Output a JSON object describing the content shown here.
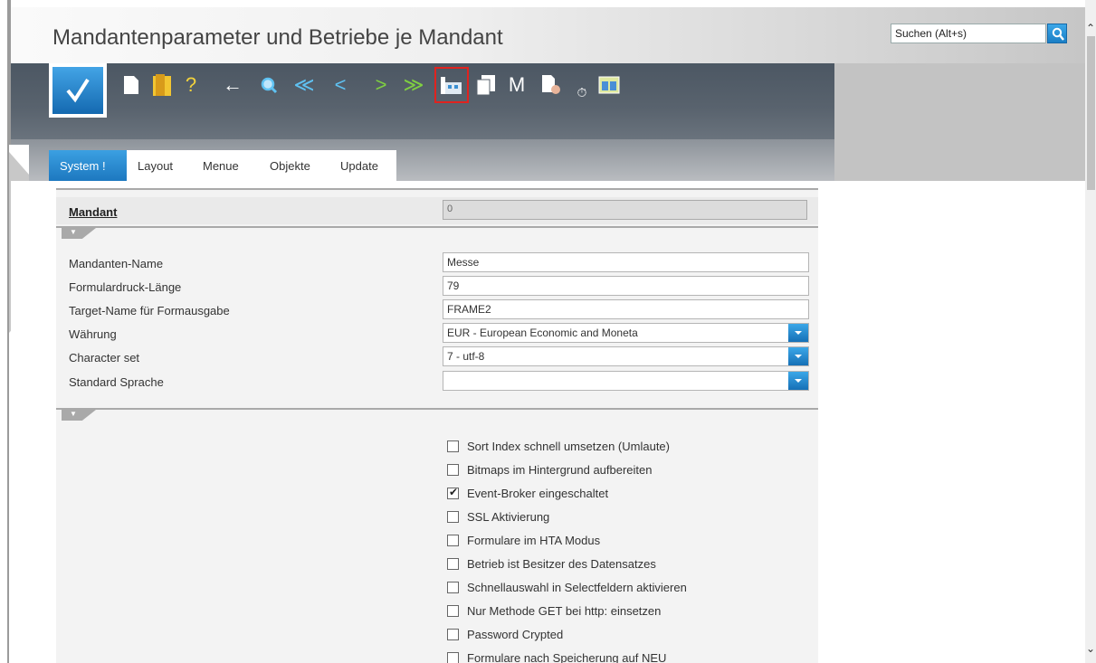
{
  "header": {
    "title": "Mandantenparameter und Betriebe je Mandant"
  },
  "search": {
    "placeholder": "Suchen (Alt+s)"
  },
  "toolbar": {
    "items": [
      {
        "name": "new-document",
        "glyph": "▯"
      },
      {
        "name": "open-folder",
        "glyph": "▮"
      },
      {
        "name": "help",
        "glyph": "?"
      },
      {
        "name": "back",
        "glyph": "←"
      },
      {
        "name": "search",
        "glyph": "⌕"
      },
      {
        "name": "first",
        "glyph": "≪"
      },
      {
        "name": "previous",
        "glyph": "<"
      },
      {
        "name": "next",
        "glyph": ">"
      },
      {
        "name": "last",
        "glyph": "≫"
      },
      {
        "name": "company",
        "glyph": "▦"
      },
      {
        "name": "copy",
        "glyph": "❐"
      },
      {
        "name": "m-mode",
        "glyph": "M"
      },
      {
        "name": "document-hand",
        "glyph": "✋"
      },
      {
        "name": "timer",
        "glyph": "⏱"
      },
      {
        "name": "table-view",
        "glyph": "▤"
      }
    ],
    "highlighted": "company"
  },
  "tabs": [
    "System !",
    "Layout",
    "Menue",
    "Objekte",
    "Update"
  ],
  "form": {
    "mandant_label": "Mandant",
    "mandant_value": "0",
    "fields": [
      {
        "label": "Mandanten-Name",
        "value": "Messe"
      },
      {
        "label": "Formulardruck-Länge",
        "value": "79"
      },
      {
        "label": "Target-Name für Formausgabe",
        "value": "FRAME2"
      },
      {
        "label": "Währung",
        "value": "EUR - European Economic and Moneta"
      },
      {
        "label": "Character set",
        "value": "7 - utf-8"
      },
      {
        "label": "Standard Sprache",
        "value": ""
      }
    ],
    "checkboxes": [
      {
        "label": "Sort Index schnell umsetzen (Umlaute)",
        "checked": false
      },
      {
        "label": "Bitmaps im Hintergrund aufbereiten",
        "checked": false
      },
      {
        "label": "Event-Broker eingeschaltet",
        "checked": true
      },
      {
        "label": "SSL Aktivierung",
        "checked": false
      },
      {
        "label": "Formulare im HTA Modus",
        "checked": false
      },
      {
        "label": "Betrieb ist Besitzer des Datensatzes",
        "checked": false
      },
      {
        "label": "Schnellauswahl in Selectfeldern aktivieren",
        "checked": false
      },
      {
        "label": "Nur Methode GET bei http: einsetzen",
        "checked": false
      },
      {
        "label": "Password Crypted",
        "checked": false
      },
      {
        "label": "Formulare nach Speicherung auf NEU",
        "checked": false
      }
    ]
  },
  "colors": {
    "accent_blue": "#1d78c0",
    "toolbar_bg": "#4c5763",
    "highlight_red": "#e0231f"
  }
}
